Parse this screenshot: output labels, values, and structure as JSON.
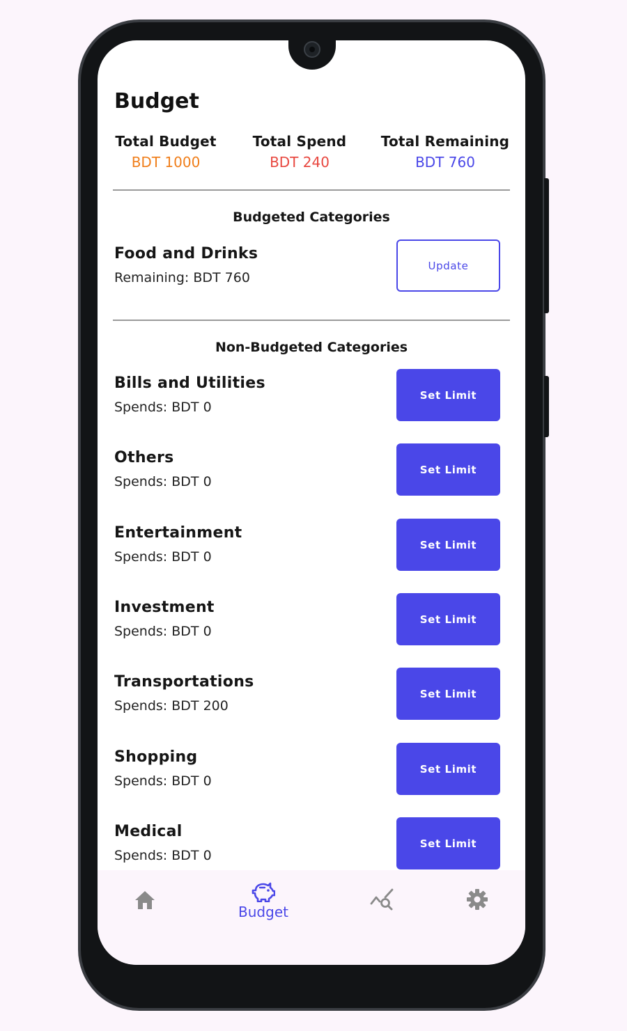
{
  "page": {
    "title": "Budget"
  },
  "summary": {
    "total_budget_label": "Total Budget",
    "total_budget_value": "BDT 1000",
    "total_spend_label": "Total Spend",
    "total_spend_value": "BDT 240",
    "total_remaining_label": "Total Remaining",
    "total_remaining_value": "BDT 760"
  },
  "budgeted": {
    "heading": "Budgeted Categories",
    "items": [
      {
        "name": "Food and Drinks",
        "detail": "Remaining: BDT 760",
        "action": "Update"
      }
    ]
  },
  "non_budgeted": {
    "heading": "Non-Budgeted Categories",
    "items": [
      {
        "name": "Bills and Utilities",
        "detail": "Spends: BDT 0",
        "action": "Set Limit"
      },
      {
        "name": "Others",
        "detail": "Spends: BDT 0",
        "action": "Set Limit"
      },
      {
        "name": "Entertainment",
        "detail": "Spends: BDT 0",
        "action": "Set Limit"
      },
      {
        "name": "Investment",
        "detail": "Spends: BDT 0",
        "action": "Set Limit"
      },
      {
        "name": "Transportations",
        "detail": "Spends: BDT 200",
        "action": "Set Limit"
      },
      {
        "name": "Shopping",
        "detail": "Spends: BDT 0",
        "action": "Set Limit"
      },
      {
        "name": "Medical",
        "detail": "Spends: BDT 0",
        "action": "Set Limit"
      }
    ]
  },
  "nav": {
    "items": [
      {
        "icon": "home-icon",
        "label": ""
      },
      {
        "icon": "piggy-bank-icon",
        "label": "Budget",
        "active": true
      },
      {
        "icon": "chart-search-icon",
        "label": ""
      },
      {
        "icon": "gear-icon",
        "label": ""
      }
    ]
  },
  "colors": {
    "accent": "#4a47e8",
    "budget_value": "#f07e1a",
    "spend_value": "#e8473f",
    "remaining_value": "#4a47e8",
    "nav_inactive": "#8a8a8a"
  }
}
